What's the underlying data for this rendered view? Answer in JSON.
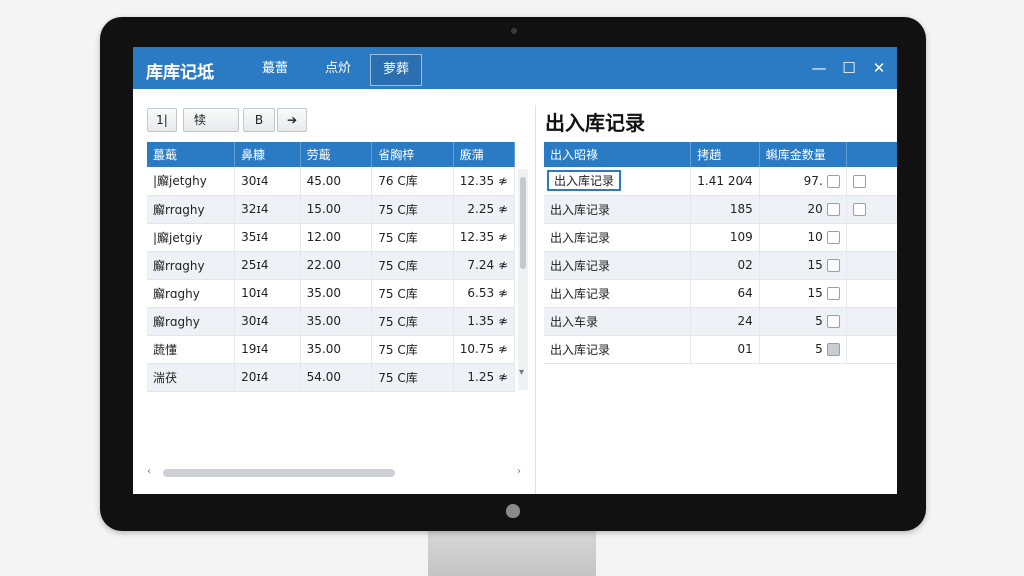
{
  "app": {
    "title": "库库记坻",
    "menu": [
      {
        "label": "蕞蕾"
      },
      {
        "label": "点炌"
      },
      {
        "label": "萝葬"
      }
    ],
    "window_controls": {
      "minimize": "—",
      "maximize": "☐",
      "close": "✕"
    }
  },
  "toolbar": {
    "btn1": "1|",
    "field": "犊",
    "btn_b": "B",
    "btn_arrow": "➔"
  },
  "left_table": {
    "headers": [
      "蕞蕺",
      "鼻糠",
      "劳蕺",
      "省胸梓",
      "廒蒲"
    ],
    "rows": [
      [
        "|廨jetghy",
        "30ɪ4",
        "45.00",
        "76 C库",
        "12.35 ≉"
      ],
      [
        "廨rrɑghy",
        "32ɪ4",
        "15.00",
        "75 C库",
        "2.25 ≉"
      ],
      [
        "|廨jetgiy",
        "35ɪ4",
        "12.00",
        "75 C库",
        "12.35 ≉"
      ],
      [
        "廨rrɑghy",
        "25ɪ4",
        "22.00",
        "75 C库",
        "7.24 ≉"
      ],
      [
        "廨rɑghy",
        "10ɪ4",
        "35.00",
        "75 C库",
        "6.53 ≉"
      ],
      [
        "廨rɑghy",
        "30ɪ4",
        "35.00",
        "75 C库",
        "1.35 ≉"
      ],
      [
        "蔬懂",
        "19ɪ4",
        "35.00",
        "75 C库",
        "10.75 ≉"
      ],
      [
        "湍茯",
        "20ɪ4",
        "54.00",
        "75 C库",
        "1.25 ≉"
      ]
    ]
  },
  "right_panel": {
    "title": "出入库记录",
    "headers": [
      "出入昭祿",
      "拷趟",
      "蝌库金数量"
    ],
    "rows": [
      {
        "name": "出入库记录",
        "qty": "1.41 20⁄4",
        "count": "97."
      },
      {
        "name": "出入库记录",
        "qty": "185",
        "count": "20"
      },
      {
        "name": "出入库记录",
        "qty": "109",
        "count": "10"
      },
      {
        "name": "出入库记录",
        "qty": "02",
        "count": "15"
      },
      {
        "name": "出入库记录",
        "qty": "64",
        "count": "15"
      },
      {
        "name": "出入车录",
        "qty": "24",
        "count": "5"
      },
      {
        "name": "出入库记录",
        "qty": "01",
        "count": "5"
      }
    ]
  }
}
